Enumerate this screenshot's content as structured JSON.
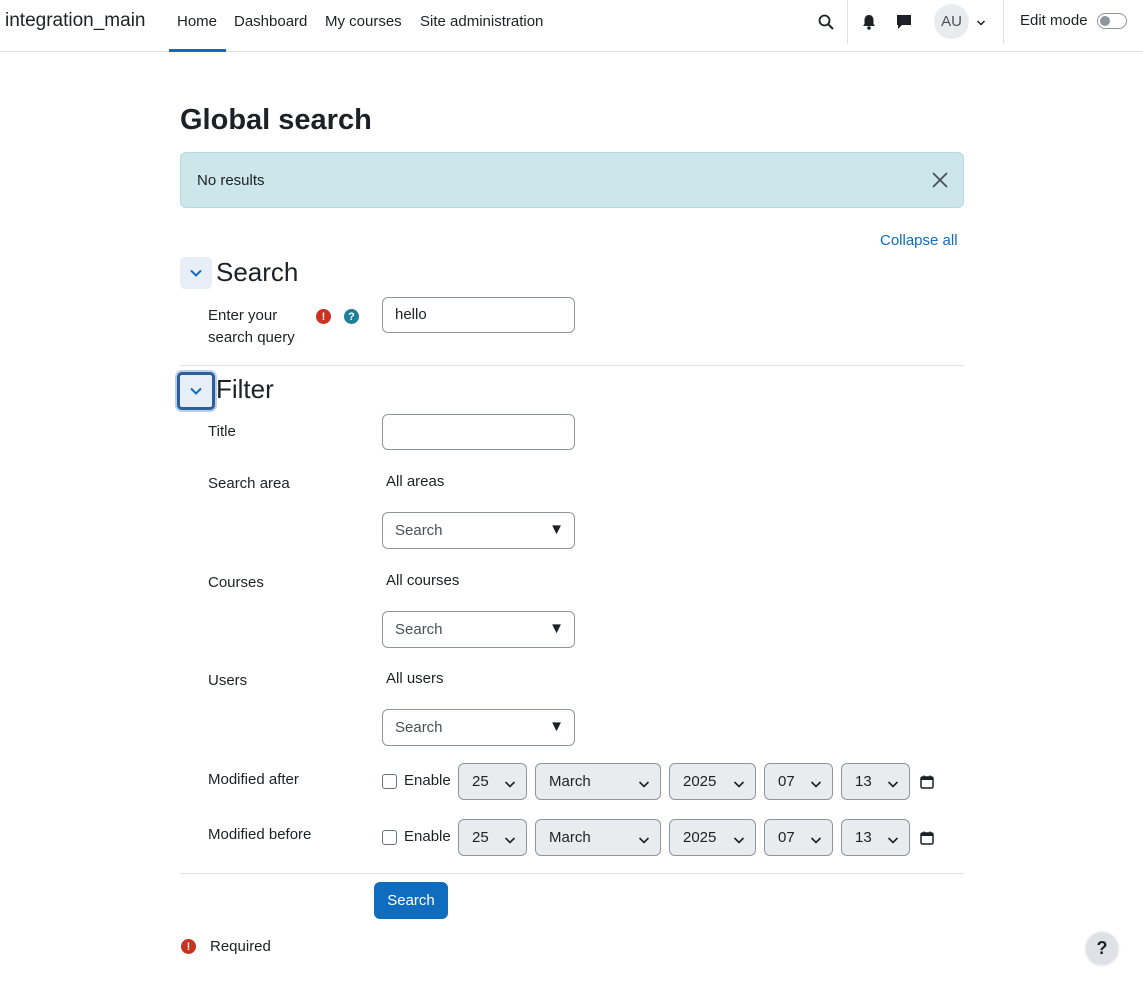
{
  "navbar": {
    "brand": "integration_main",
    "items": [
      {
        "label": "Home",
        "active": true
      },
      {
        "label": "Dashboard",
        "active": false
      },
      {
        "label": "My courses",
        "active": false
      },
      {
        "label": "Site administration",
        "active": false
      }
    ],
    "icons": [
      "search-icon",
      "bell-icon",
      "chat-icon"
    ],
    "avatar_initials": "AU",
    "edit_mode_label": "Edit mode",
    "edit_mode_on": false
  },
  "page": {
    "title": "Global search",
    "alert_text": "No results",
    "collapse_all": "Collapse all"
  },
  "search_section": {
    "title": "Search",
    "query_label": "Enter your search query",
    "query_value": "hello"
  },
  "filter_section": {
    "title": "Filter",
    "title_label": "Title",
    "title_value": "",
    "search_area": {
      "label": "Search area",
      "selection": "All areas",
      "placeholder": "Search"
    },
    "courses": {
      "label": "Courses",
      "selection": "All courses",
      "placeholder": "Search"
    },
    "users": {
      "label": "Users",
      "selection": "All users",
      "placeholder": "Search"
    },
    "modified_after": {
      "label": "Modified after",
      "enable_label": "Enable",
      "enabled": false,
      "day": "25",
      "month": "March",
      "year": "2025",
      "hour": "07",
      "minute": "13"
    },
    "modified_before": {
      "label": "Modified before",
      "enable_label": "Enable",
      "enabled": false,
      "day": "25",
      "month": "March",
      "year": "2025",
      "hour": "07",
      "minute": "13"
    }
  },
  "submit_label": "Search",
  "required_label": "Required",
  "help_glyph": "?",
  "colors": {
    "primary": "#0f6cbf",
    "alert_bg": "#cce6ea",
    "required": "#ca3120",
    "help": "#1f7e9a"
  }
}
